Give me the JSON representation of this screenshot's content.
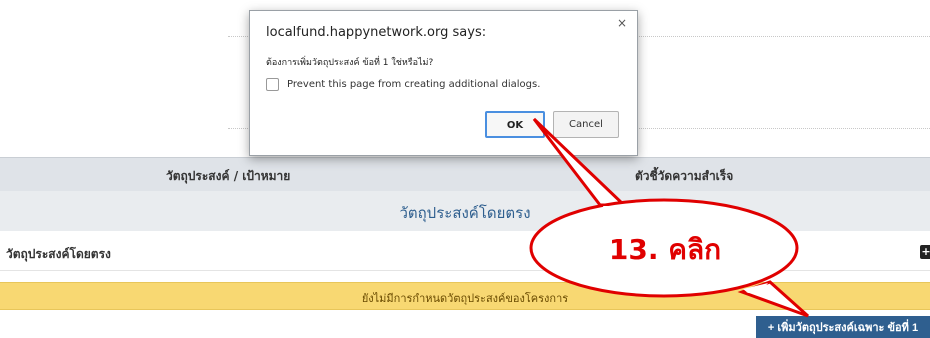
{
  "dialog": {
    "title": "localfund.happynetwork.org says:",
    "close_label": "×",
    "message": "ต้องการเพิ่มวัตถุประสงค์ ข้อที่ 1 ใช่หรือไม่?",
    "checkbox_label": "Prevent this page from creating additional dialogs.",
    "ok_label": "OK",
    "cancel_label": "Cancel"
  },
  "table": {
    "headers": [
      "วัตถุประสงค์ / เป้าหมาย",
      "ตัวชี้วัดความสำเร็จ"
    ]
  },
  "section": {
    "title": "วัตถุประสงค์โดยตรง",
    "row_label": "วัตถุประสงค์โดยตรง",
    "plus_icon": "+"
  },
  "notice": {
    "text": "ยังไม่มีการกำหนดวัตถุประสงค์ของโครงการ"
  },
  "add_button": {
    "label": "+ เพิ่มวัตถุประสงค์เฉพาะ ข้อที่ 1"
  },
  "annotation": {
    "callout_text": "13. คลิก",
    "color": "#e00000"
  }
}
